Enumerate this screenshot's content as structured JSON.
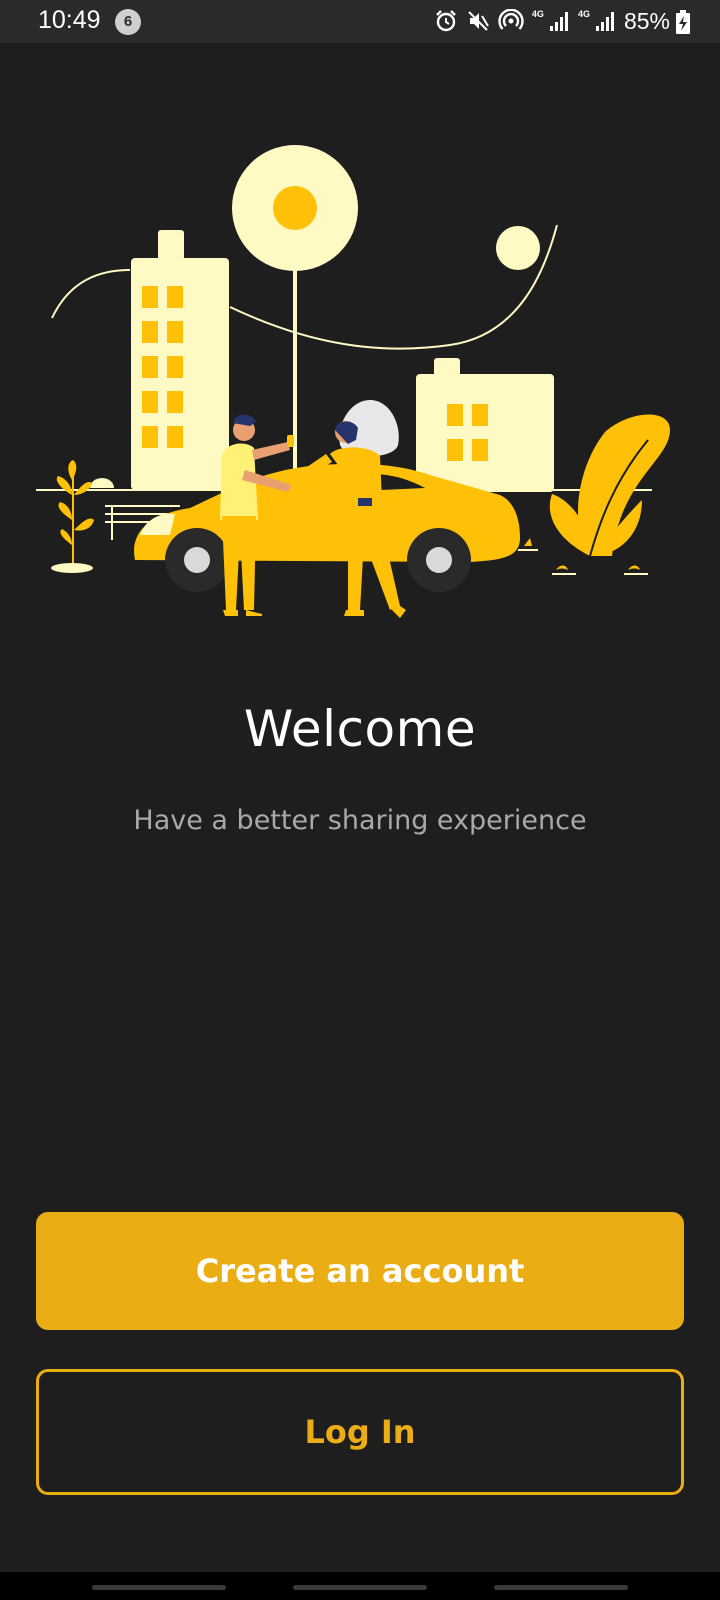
{
  "status_bar": {
    "time": "10:49",
    "notification_count": "6",
    "network_1": "4G",
    "network_2": "4G",
    "battery_percent": "85%",
    "icons": [
      "alarm-icon",
      "mute-icon",
      "hotspot-icon",
      "signal-icon",
      "signal-icon",
      "battery-charging-icon"
    ]
  },
  "illustration": {
    "description_icon": "car-handshake-illustration",
    "colors": {
      "yellow": "#ffc107",
      "light_yellow": "#fff9c4",
      "dark": "#1e1e1e"
    }
  },
  "welcome": {
    "title": "Welcome",
    "subtitle": "Have a better sharing experience"
  },
  "actions": {
    "create_account_label": "Create an account",
    "login_label": "Log In"
  },
  "theme": {
    "background": "#1e1e1e",
    "accent": "#ebad14",
    "text_primary": "#ffffff",
    "text_secondary": "#a9a9a9"
  }
}
